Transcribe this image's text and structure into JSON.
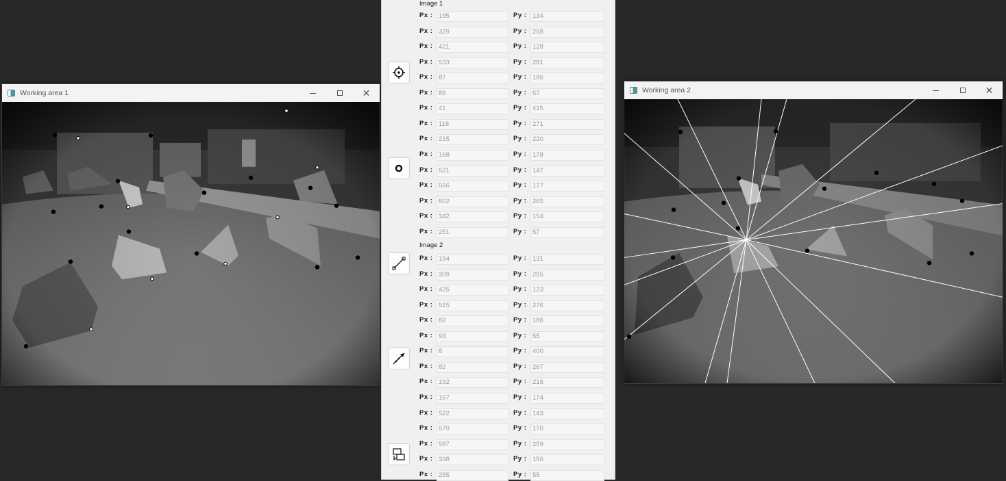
{
  "window1": {
    "title": "Working area 1"
  },
  "window2": {
    "title": "Working area 2"
  },
  "panel": {
    "image1_label": "Image 1",
    "image2_label": "Image 2",
    "px_label": "Px :",
    "py_label": "Py :",
    "tools": [
      {
        "name": "crosshair-target-icon"
      },
      {
        "name": "circle-ring-icon"
      },
      {
        "name": "line-segment-icon"
      },
      {
        "name": "arrow-line-icon"
      },
      {
        "name": "split-view-icon"
      }
    ],
    "image1_points": [
      {
        "px": "195",
        "py": "134"
      },
      {
        "px": "329",
        "py": "258"
      },
      {
        "px": "421",
        "py": "128"
      },
      {
        "px": "533",
        "py": "281"
      },
      {
        "px": "87",
        "py": "186"
      },
      {
        "px": "89",
        "py": "57"
      },
      {
        "px": "41",
        "py": "415"
      },
      {
        "px": "116",
        "py": "271"
      },
      {
        "px": "215",
        "py": "220"
      },
      {
        "px": "168",
        "py": "178"
      },
      {
        "px": "521",
        "py": "147"
      },
      {
        "px": "566",
        "py": "177"
      },
      {
        "px": "602",
        "py": "265"
      },
      {
        "px": "342",
        "py": "154"
      },
      {
        "px": "251",
        "py": "57"
      }
    ],
    "image2_points": [
      {
        "px": "194",
        "py": "131"
      },
      {
        "px": "309",
        "py": "255"
      },
      {
        "px": "425",
        "py": "123"
      },
      {
        "px": "515",
        "py": "276"
      },
      {
        "px": "82",
        "py": "186"
      },
      {
        "px": "93",
        "py": "55"
      },
      {
        "px": "8",
        "py": "400"
      },
      {
        "px": "82",
        "py": "267"
      },
      {
        "px": "192",
        "py": "216"
      },
      {
        "px": "167",
        "py": "174"
      },
      {
        "px": "522",
        "py": "143"
      },
      {
        "px": "570",
        "py": "170"
      },
      {
        "px": "587",
        "py": "259"
      },
      {
        "px": "338",
        "py": "150"
      },
      {
        "px": "255",
        "py": "55"
      }
    ]
  }
}
